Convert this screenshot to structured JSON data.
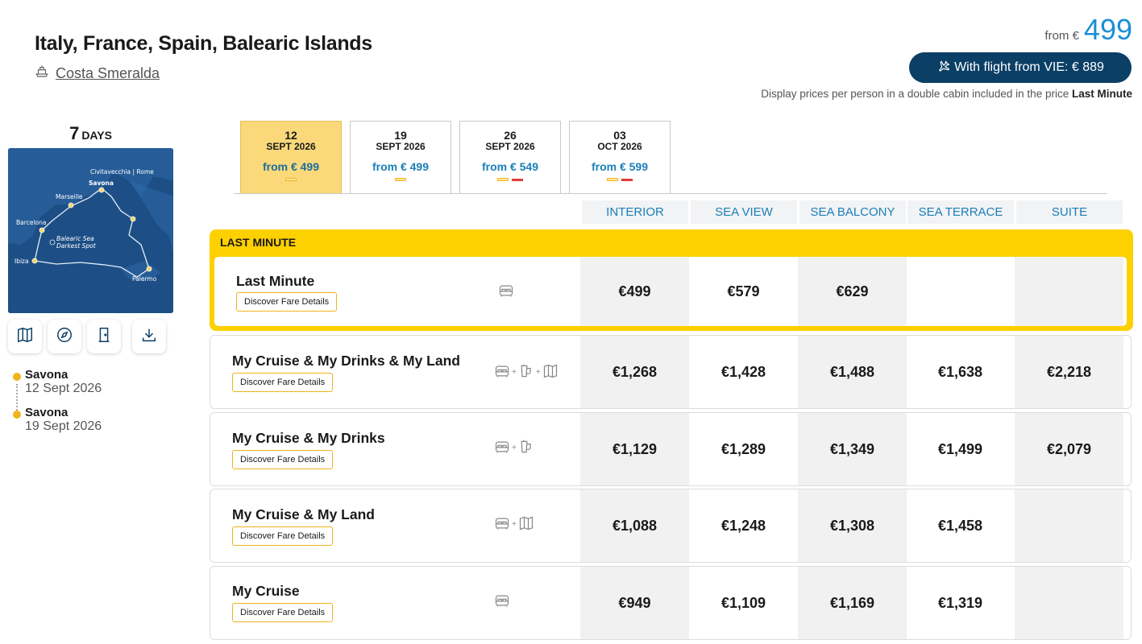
{
  "header": {
    "title": "Italy, France, Spain, Balearic Islands",
    "ship": "Costa Smeralda",
    "price_from_label": "from €",
    "price_from_value": "499",
    "flight_button": "With flight from VIE: € 889",
    "disclaimer_prefix": "Display prices per person in a double cabin included in the price",
    "disclaimer_bold": "Last Minute"
  },
  "sidebar": {
    "days_number": "7",
    "days_label": "DAYS",
    "map_labels": {
      "civitavecchia": "Civitavecchia | Rome",
      "savona": "Savona",
      "marseille": "Marseille",
      "barcelona": "Barcelona",
      "balearic": "Balearic Sea",
      "darkest": "Darkest Spot",
      "ibiza": "Ibiza",
      "palermo": "Palermo"
    },
    "tools": [
      "map-icon",
      "compass-icon",
      "door-icon",
      "download-icon"
    ],
    "itinerary": [
      {
        "port": "Savona",
        "date": "12 Sept 2026"
      },
      {
        "port": "Savona",
        "date": "19 Sept 2026"
      }
    ]
  },
  "dates": [
    {
      "day": "12",
      "month": "SEPT 2026",
      "price": "from € 499",
      "active": true,
      "marks": [
        "y"
      ]
    },
    {
      "day": "19",
      "month": "SEPT 2026",
      "price": "from € 499",
      "active": false,
      "marks": [
        "y"
      ]
    },
    {
      "day": "26",
      "month": "SEPT 2026",
      "price": "from € 549",
      "active": false,
      "marks": [
        "y",
        "r"
      ]
    },
    {
      "day": "03",
      "month": "OCT 2026",
      "price": "from € 599",
      "active": false,
      "marks": [
        "y",
        "r"
      ]
    }
  ],
  "cabins": [
    "INTERIOR",
    "SEA VIEW",
    "SEA BALCONY",
    "SEA TERRACE",
    "SUITE"
  ],
  "last_minute_label": "LAST MINUTE",
  "fare_details_label": "Discover Fare Details",
  "fares": [
    {
      "name": "Last Minute",
      "icons": [
        "bed-icon"
      ],
      "prices": [
        "€499",
        "€579",
        "€629",
        "",
        ""
      ]
    },
    {
      "name": "My Cruise & My Drinks & My Land",
      "icons": [
        "bed-icon",
        "drinks-icon",
        "land-map-icon"
      ],
      "prices": [
        "€1,268",
        "€1,428",
        "€1,488",
        "€1,638",
        "€2,218"
      ]
    },
    {
      "name": "My Cruise & My Drinks",
      "icons": [
        "bed-icon",
        "drinks-icon"
      ],
      "prices": [
        "€1,129",
        "€1,289",
        "€1,349",
        "€1,499",
        "€2,079"
      ]
    },
    {
      "name": "My Cruise & My Land",
      "icons": [
        "bed-icon",
        "land-map-icon"
      ],
      "prices": [
        "€1,088",
        "€1,248",
        "€1,308",
        "€1,458",
        ""
      ]
    },
    {
      "name": "My Cruise",
      "icons": [
        "bed-icon"
      ],
      "prices": [
        "€949",
        "€1,109",
        "€1,169",
        "€1,319",
        ""
      ]
    }
  ],
  "colors": {
    "accent_blue": "#1a8fd6",
    "navy": "#0b3f66",
    "last_minute_yellow": "#fdd000",
    "active_tab": "#fbd97a",
    "dot_yellow": "#f2b31c"
  }
}
